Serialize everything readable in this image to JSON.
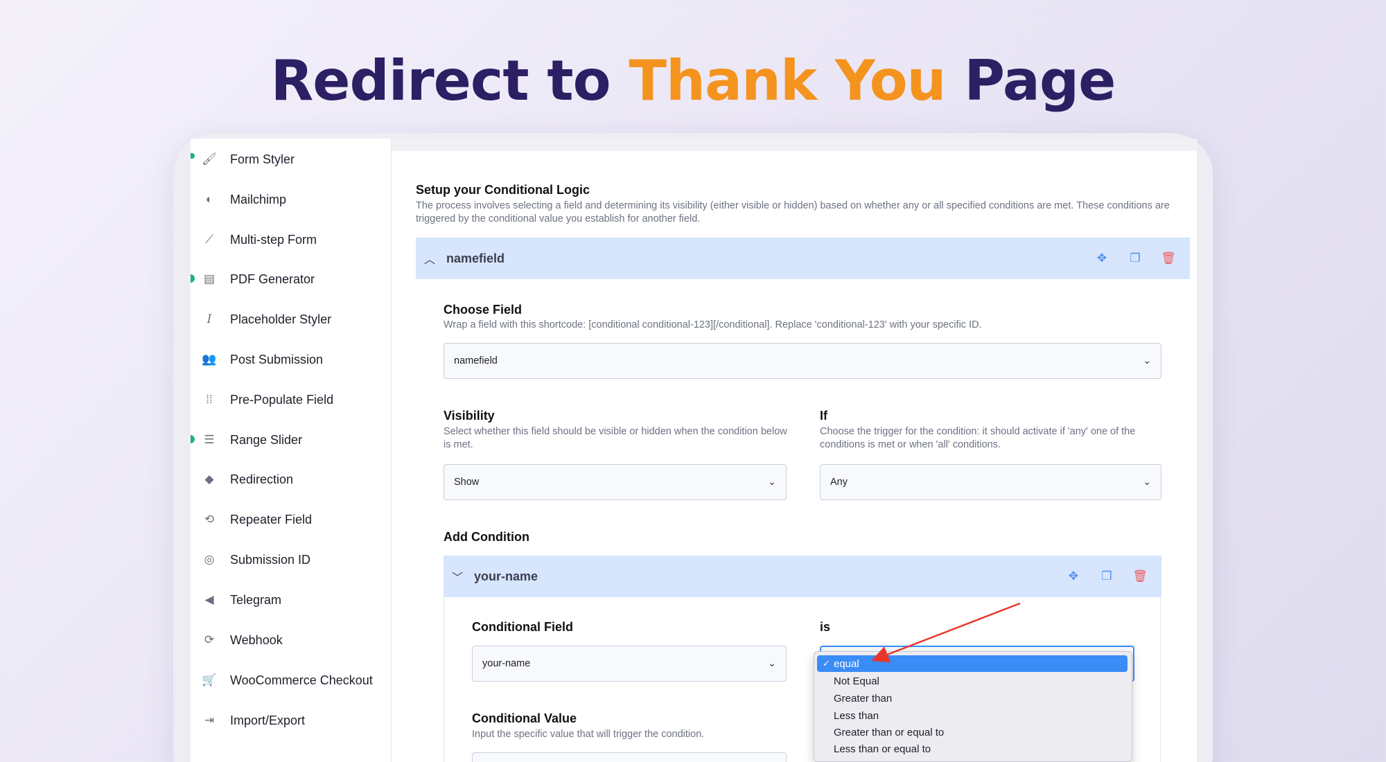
{
  "headline": {
    "part1": "Redirect to ",
    "accent": "Thank You",
    "part2": " Page"
  },
  "colors": {
    "brand_dark": "#2c1f63",
    "accent_orange": "#f4931e",
    "panel_blue": "#d7e5fd",
    "action_blue": "#4f8ff0",
    "danger": "#ee5d5d",
    "status_green": "#22b07d"
  },
  "sidebar": {
    "items": [
      {
        "label": "Form Styler",
        "icon": "brush-icon"
      },
      {
        "label": "Mailchimp",
        "icon": "mailchimp-icon"
      },
      {
        "label": "Multi-step Form",
        "icon": "steps-icon"
      },
      {
        "label": "PDF Generator",
        "icon": "pdf-icon"
      },
      {
        "label": "Placeholder Styler",
        "icon": "italic-icon"
      },
      {
        "label": "Post Submission",
        "icon": "post-icon"
      },
      {
        "label": "Pre-Populate Field",
        "icon": "grid-icon"
      },
      {
        "label": "Range Slider",
        "icon": "sliders-icon"
      },
      {
        "label": "Redirection",
        "icon": "diamond-icon"
      },
      {
        "label": "Repeater Field",
        "icon": "repeat-icon"
      },
      {
        "label": "Submission ID",
        "icon": "fingerprint-icon"
      },
      {
        "label": "Telegram",
        "icon": "telegram-icon"
      },
      {
        "label": "Webhook",
        "icon": "webhook-icon"
      },
      {
        "label": "WooCommerce Checkout",
        "icon": "cart-icon"
      },
      {
        "label": "Import/Export",
        "icon": "import-export-icon"
      }
    ]
  },
  "main": {
    "title": "Setup your Conditional Logic",
    "description": "The process involves selecting a field and determining its visibility (either visible or hidden) based on whether any or all specified conditions are met. These conditions are triggered by the conditional value you establish for another field.",
    "panel": {
      "title": "namefield",
      "choose_field": {
        "label": "Choose Field",
        "help": "Wrap a field with this shortcode: [conditional conditional-123][/conditional]. Replace 'conditional-123' with your specific ID.",
        "value": "namefield"
      },
      "visibility": {
        "label": "Visibility",
        "help": "Select whether this field should be visible or hidden when the condition below is met.",
        "value": "Show"
      },
      "if": {
        "label": "If",
        "help": "Choose the trigger for the condition: it should activate if 'any' one of the conditions is met or when 'all' conditions.",
        "value": "Any"
      },
      "add_condition": "Add Condition",
      "condition": {
        "title": "your-name",
        "conditional_field": {
          "label": "Conditional Field",
          "value": "your-name"
        },
        "is": {
          "label": "is",
          "options": [
            "equal",
            "Not Equal",
            "Greater than",
            "Less than",
            "Greater than or equal to",
            "Less than or equal to"
          ],
          "selected": "equal"
        },
        "conditional_value": {
          "label": "Conditional Value",
          "help": "Input the specific value that will trigger the condition."
        }
      }
    }
  }
}
